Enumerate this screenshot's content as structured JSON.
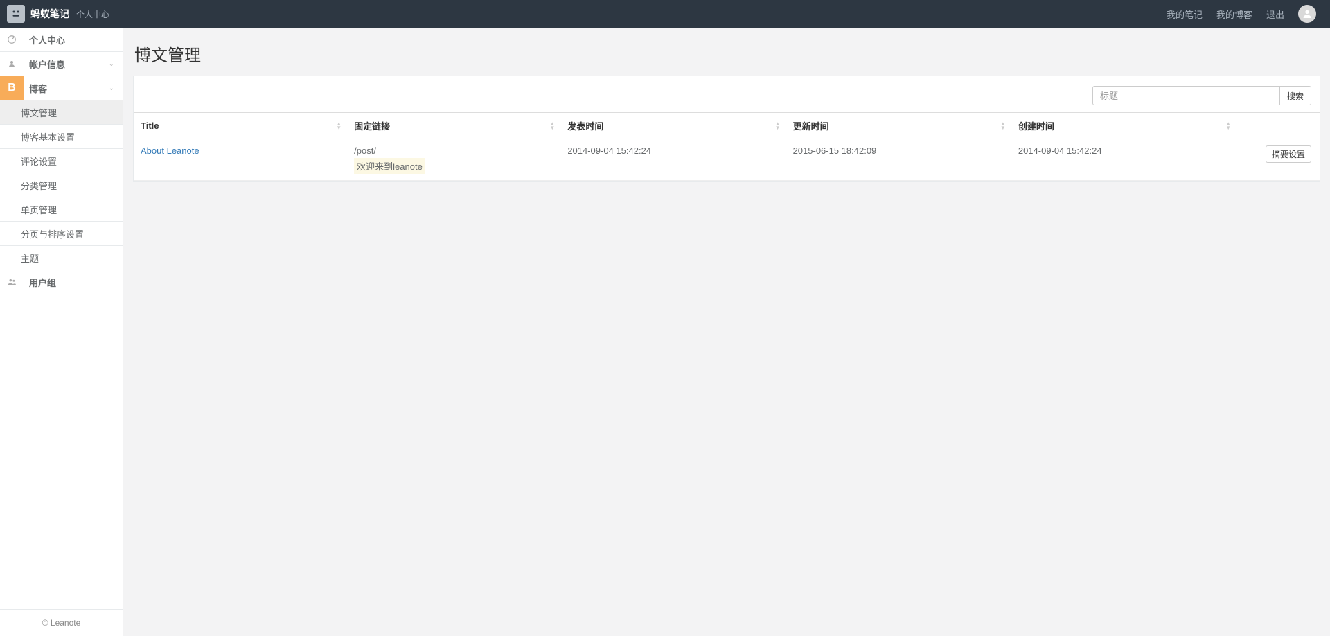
{
  "header": {
    "brand": "蚂蚁笔记",
    "brand_sub": "个人中心",
    "links": {
      "notes": "我的笔记",
      "blog": "我的博客",
      "logout": "退出"
    }
  },
  "sidebar": {
    "personal_center": "个人中心",
    "account_info": "帐户信息",
    "blog": "博客",
    "blog_badge": "B",
    "user_group": "用户组",
    "sub": {
      "post_manage": "博文管理",
      "basic_settings": "博客基本设置",
      "comment_settings": "评论设置",
      "category_manage": "分类管理",
      "single_page_manage": "单页管理",
      "paging_sort_settings": "分页与排序设置",
      "theme": "主题"
    },
    "footer": "© Leanote"
  },
  "page": {
    "title": "博文管理"
  },
  "search": {
    "placeholder": "标题",
    "button": "搜索"
  },
  "table": {
    "headers": {
      "title": "Title",
      "permalink": "固定链接",
      "publish_time": "发表时间",
      "update_time": "更新时间",
      "create_time": "创建时间"
    },
    "rows": [
      {
        "title": "About Leanote",
        "permalink": "/post/",
        "excerpt": "欢迎来到leanote",
        "publish_time": "2014-09-04 15:42:24",
        "update_time": "2015-06-15 18:42:09",
        "create_time": "2014-09-04 15:42:24",
        "action": "摘要设置"
      }
    ]
  }
}
